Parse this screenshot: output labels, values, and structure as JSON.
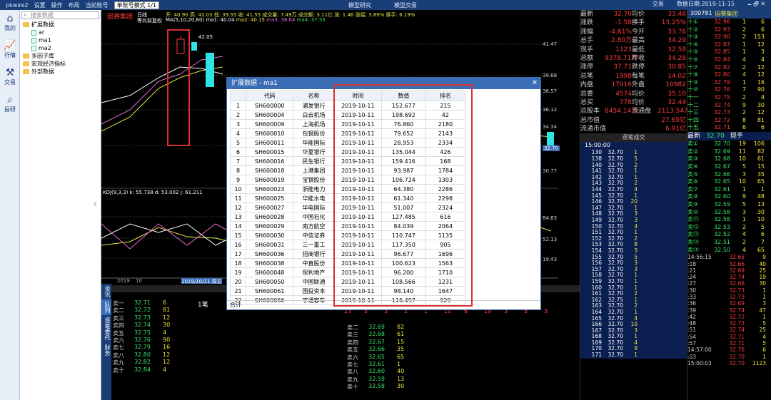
{
  "topbar": {
    "app": "pkwire2",
    "settings": "设置",
    "operate": "操作",
    "layout": "布局",
    "account": "当前账号",
    "mode_value": "单账号模式 1/1",
    "analysis": "模型研究",
    "trade_btn": "模型交易",
    "user": "交易",
    "date": "数据日期:2019-11-15"
  },
  "leftnav": [
    {
      "label": "我的",
      "icon": "home-icon"
    },
    {
      "label": "行情",
      "icon": "chart-icon"
    },
    {
      "label": "交易",
      "icon": "tools-icon"
    },
    {
      "label": "投研",
      "icon": "search-icon"
    }
  ],
  "tree": {
    "search_placeholder": "搜索数据",
    "items": [
      {
        "label": "扩展数据",
        "type": "folder",
        "level": 0
      },
      {
        "label": "ar",
        "type": "file",
        "level": 1
      },
      {
        "label": "ma1",
        "type": "file",
        "level": 1
      },
      {
        "label": "ma2",
        "type": "file",
        "level": 1
      },
      {
        "label": "多因子库",
        "type": "folder",
        "level": 0
      },
      {
        "label": "宏观经济指标",
        "type": "folder",
        "level": 0
      },
      {
        "label": "外部数据",
        "type": "folder",
        "level": 0
      }
    ]
  },
  "chart": {
    "stock": "因赛集团",
    "period": "日线",
    "adj": "等比前复权",
    "ma": "MA(5,10,20,60)",
    "ma1": "ma1: 40.04",
    "ma2": "ma2: 40.15",
    "ma3": "ma3: 38.64",
    "ma4": "ma4: 37.55",
    "info": "开: 40.90  高: 42.03  低: 39.55  收: 41.55  成交量: 7.49万  成交额: 3.11亿  涨: 1.46  涨幅: 3.89%  换手: 6.19%",
    "peak": "42.05",
    "kdj": "KDJ(9,3,3)  k: 55.738  d: 53.002  j: 61.211",
    "yaxis": [
      "41.47",
      "39.68",
      "38.57",
      "36.12",
      "34.34",
      "32.70",
      "30.77",
      "84.63",
      "52.13",
      "19.43"
    ],
    "xaxis": [
      "2019",
      "10",
      "2019/10/11 周五"
    ]
  },
  "modal": {
    "title": "扩展数据 - ma1",
    "columns": [
      "",
      "代码",
      "名称",
      "时间",
      "数值",
      "排名"
    ],
    "rows": [
      [
        "1",
        "SH600000",
        "浦发银行",
        "2019-10-11",
        "152.677",
        "215"
      ],
      [
        "2",
        "SH600004",
        "白云机场",
        "2019-10-11",
        "198.692",
        "42"
      ],
      [
        "3",
        "SH600009",
        "上海机场",
        "2019-10-11",
        "76.860",
        "2180"
      ],
      [
        "4",
        "SH600010",
        "包钢股份",
        "2019-10-11",
        "79.652",
        "2143"
      ],
      [
        "5",
        "SH600011",
        "华能国际",
        "2019-10-11",
        "28.953",
        "2334"
      ],
      [
        "6",
        "SH600015",
        "华夏银行",
        "2019-10-11",
        "135.044",
        "426"
      ],
      [
        "7",
        "SH600016",
        "民生银行",
        "2019-10-11",
        "159.416",
        "168"
      ],
      [
        "8",
        "SH600018",
        "上港集团",
        "2019-10-11",
        "93.987",
        "1784"
      ],
      [
        "9",
        "SH600019",
        "宝钢股份",
        "2019-10-11",
        "106.724",
        "1303"
      ],
      [
        "10",
        "SH600023",
        "浙能电力",
        "2019-10-11",
        "64.380",
        "2286"
      ],
      [
        "11",
        "SH600025",
        "华能水电",
        "2019-10-11",
        "61.340",
        "2298"
      ],
      [
        "12",
        "SH600027",
        "华电国际",
        "2019-10-11",
        "51.007",
        "2324"
      ],
      [
        "13",
        "SH600028",
        "中国石化",
        "2019-10-11",
        "127.485",
        "616"
      ],
      [
        "14",
        "SH600029",
        "南方航空",
        "2019-10-11",
        "84.039",
        "2064"
      ],
      [
        "15",
        "SH600030",
        "中信证券",
        "2019-10-11",
        "110.747",
        "1135"
      ],
      [
        "16",
        "SH600031",
        "三一重工",
        "2019-10-11",
        "117.350",
        "905"
      ],
      [
        "17",
        "SH600036",
        "招商银行",
        "2019-10-11",
        "96.677",
        "1696"
      ],
      [
        "18",
        "SH600038",
        "中直股份",
        "2019-10-11",
        "100.623",
        "1563"
      ],
      [
        "19",
        "SH600048",
        "保利地产",
        "2019-10-11",
        "96.200",
        "1710"
      ],
      [
        "20",
        "SH600050",
        "中国联通",
        "2019-10-11",
        "108.566",
        "1231"
      ],
      [
        "21",
        "SH600061",
        "国投资本",
        "2019-10-11",
        "98.140",
        "1647"
      ],
      [
        "22",
        "SH600066",
        "宇通客车",
        "2019-10-11",
        "116.497",
        "929"
      ]
    ],
    "footer": "合计"
  },
  "dock": {
    "tabs": [
      "资讯",
      "队列",
      "逐笔委托",
      "财务"
    ],
    "header": "委卖队列(共10档 ...)",
    "lots": "1笔",
    "sell_left": [
      [
        "卖一",
        "32.71",
        "6"
      ],
      [
        "卖二",
        "32.72",
        "81"
      ],
      [
        "卖三",
        "32.73",
        "12"
      ],
      [
        "卖四",
        "32.74",
        "30"
      ],
      [
        "卖五",
        "32.75",
        "4"
      ],
      [
        "卖六",
        "32.76",
        "90"
      ],
      [
        "卖七",
        "32.79",
        "16"
      ],
      [
        "卖八",
        "32.80",
        "12"
      ],
      [
        "卖九",
        "32.82",
        "12"
      ],
      [
        "卖十",
        "32.84",
        "4"
      ]
    ],
    "sell_right": [
      [
        "卖二",
        "32.69",
        "82"
      ],
      [
        "卖三",
        "32.68",
        "61"
      ],
      [
        "卖四",
        "32.67",
        "15"
      ],
      [
        "卖五",
        "32.66",
        "35"
      ],
      [
        "卖六",
        "32.65",
        "65"
      ],
      [
        "卖七",
        "32.61",
        "1"
      ],
      [
        "卖八",
        "32.60",
        "40"
      ],
      [
        "卖九",
        "32.59",
        "13"
      ],
      [
        "卖十",
        "32.58",
        "30"
      ]
    ],
    "bar": [
      "23",
      "5",
      "3",
      "2",
      "1",
      "10",
      "6",
      "19",
      "3",
      "5",
      "3"
    ]
  },
  "quote": {
    "rows": [
      [
        "最新",
        "32.70",
        "均价",
        "33.48"
      ],
      [
        "涨跌",
        "-1.58",
        "换手",
        "13.25%"
      ],
      [
        "涨幅",
        "-4.61%",
        "今开",
        "33.76"
      ],
      [
        "总手",
        "2.80万",
        "最高",
        "34.29"
      ],
      [
        "现手",
        "1123",
        "最低",
        "32.58"
      ],
      [
        "总额",
        "9378.71万",
        "昨收",
        "34.28"
      ],
      [
        "涨停",
        "37.71",
        "跌停",
        "30.85"
      ],
      [
        "总笔",
        "1998",
        "每笔",
        "14.02"
      ],
      [
        "内盘",
        "17016",
        "外盘",
        "10982"
      ],
      [
        "总委",
        "4574",
        "均价",
        "35.10"
      ],
      [
        "总买",
        "778",
        "均价",
        "32.44"
      ],
      [
        "总股本",
        "8454.14万",
        "流通盘",
        "2113.54万"
      ],
      [
        "总市值",
        "",
        "",
        "27.65亿"
      ],
      [
        "流通市值",
        "",
        "",
        "6.91亿"
      ]
    ],
    "ticks_title": "逐笔成交",
    "ticks_time": "15:00:00",
    "ticks": [
      [
        "130",
        "32.70",
        "1"
      ],
      [
        "138",
        "32.70",
        "5"
      ],
      [
        "140",
        "32.70",
        "2"
      ],
      [
        "141",
        "32.70",
        "1"
      ],
      [
        "142",
        "32.70",
        "1"
      ],
      [
        "143",
        "32.70",
        "2"
      ],
      [
        "144",
        "32.70",
        "4"
      ],
      [
        "145",
        "32.70",
        "1"
      ],
      [
        "146",
        "32.70",
        "20"
      ],
      [
        "147",
        "32.70",
        "1"
      ],
      [
        "148",
        "32.70",
        "3"
      ],
      [
        "149",
        "32.70",
        "3"
      ],
      [
        "150",
        "32.70",
        "4"
      ],
      [
        "151",
        "32.70",
        "1"
      ],
      [
        "152",
        "32.70",
        "2"
      ],
      [
        "153",
        "32.70",
        "8"
      ],
      [
        "154",
        "32.70",
        "3"
      ],
      [
        "155",
        "32.70",
        "5"
      ],
      [
        "156",
        "32.70",
        "3"
      ],
      [
        "157",
        "32.70",
        "3"
      ],
      [
        "158",
        "32.70",
        "1"
      ],
      [
        "159",
        "32.70",
        "1"
      ],
      [
        "160",
        "32.70",
        "1"
      ],
      [
        "161",
        "32.70",
        "2"
      ],
      [
        "162",
        "32.75",
        "1"
      ],
      [
        "163",
        "32.70",
        "2"
      ],
      [
        "164",
        "32.70",
        "1"
      ],
      [
        "165",
        "32.70",
        "4"
      ],
      [
        "166",
        "32.70",
        "10"
      ],
      [
        "167",
        "32.70",
        "3"
      ],
      [
        "168",
        "32.70",
        "1"
      ],
      [
        "169",
        "32.70",
        "4"
      ],
      [
        "170",
        "32.70",
        "9"
      ],
      [
        "171",
        "32.70",
        "1"
      ]
    ]
  },
  "quote2": {
    "code": "300781",
    "name": "因赛集团",
    "buys": [
      [
        "十①",
        "32.96",
        "1",
        "6"
      ],
      [
        "十②",
        "32.93",
        "2",
        "6"
      ],
      [
        "十③",
        "32.90",
        "2",
        "153"
      ],
      [
        "十④",
        "32.87",
        "1",
        "12"
      ],
      [
        "十⑤",
        "32.85",
        "1",
        "3"
      ],
      [
        "十⑥",
        "32.84",
        "4",
        "4"
      ],
      [
        "十⑦",
        "32.82",
        "2",
        "12"
      ],
      [
        "十⑧",
        "32.80",
        "4",
        "12"
      ],
      [
        "十⑨",
        "32.79",
        "1",
        "16"
      ],
      [
        "十⑩",
        "32.76",
        "7",
        "90"
      ],
      [
        "十一",
        "32.75",
        "2",
        "4"
      ],
      [
        "十二",
        "32.74",
        "9",
        "30"
      ],
      [
        "十三",
        "32.73",
        "2",
        "12"
      ],
      [
        "十四",
        "32.72",
        "8",
        "81"
      ],
      [
        "十五",
        "32.71",
        "6",
        "6"
      ]
    ],
    "latest": "最新",
    "latest_val": "32.70",
    "spot": "现手",
    "sells": [
      [
        "卖①",
        "32.70",
        "19",
        "106"
      ],
      [
        "卖②",
        "32.69",
        "11",
        "82"
      ],
      [
        "卖③",
        "32.68",
        "10",
        "61"
      ],
      [
        "卖④",
        "32.67",
        "5",
        "15"
      ],
      [
        "卖⑤",
        "32.66",
        "3",
        "35"
      ],
      [
        "卖⑥",
        "32.65",
        "10",
        "65"
      ],
      [
        "卖⑦",
        "32.61",
        "1",
        "1"
      ],
      [
        "卖⑧",
        "32.60",
        "9",
        "48"
      ],
      [
        "卖⑨",
        "32.59",
        "5",
        "13"
      ],
      [
        "卖⑩",
        "32.58",
        "3",
        "30"
      ],
      [
        "卖⑪",
        "32.56",
        "1",
        "10"
      ],
      [
        "卖⑫",
        "32.53",
        "2",
        "5"
      ],
      [
        "卖⑬",
        "32.52",
        "4",
        "6"
      ],
      [
        "卖⑭",
        "32.51",
        "2",
        "7"
      ],
      [
        "卖⑮",
        "32.50",
        "4",
        "65"
      ]
    ],
    "times": [
      [
        "14:56:15",
        "32.65",
        "9"
      ],
      [
        ":18",
        "32.66",
        "40"
      ],
      [
        ":21",
        "32.69",
        "25"
      ],
      [
        ":24",
        "32.74",
        "19"
      ],
      [
        ":27",
        "32.66",
        "30"
      ],
      [
        ":30",
        "32.73",
        "1"
      ],
      [
        ":33",
        "32.73",
        "1"
      ],
      [
        ":36",
        "32.69",
        "3"
      ],
      [
        ":39",
        "32.74",
        "47"
      ],
      [
        ":42",
        "32.72",
        "1"
      ],
      [
        ":48",
        "32.73",
        "5"
      ],
      [
        ":51",
        "32.74",
        "25"
      ],
      [
        ":54",
        "32.71",
        "4"
      ],
      [
        ":57",
        "32.71",
        "5"
      ],
      [
        "14:57:00",
        "32.76",
        "6"
      ],
      [
        ":03",
        "32.70",
        "1"
      ],
      [
        "15:00:03",
        "32.70",
        "1123"
      ]
    ]
  }
}
